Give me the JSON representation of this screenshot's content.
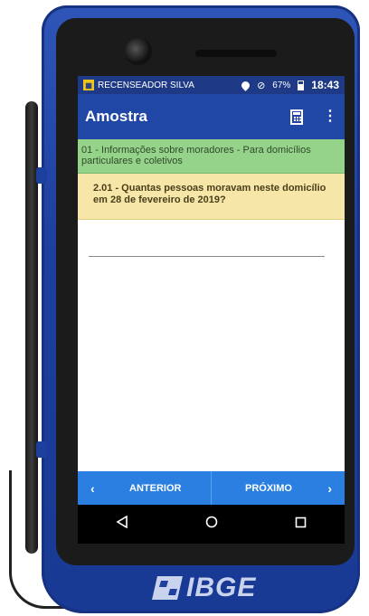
{
  "status_bar": {
    "app_name": "RECENSEADOR SILVA",
    "battery": "67%",
    "time": "18:43",
    "icons": [
      "location-pin-icon",
      "wifi-off-icon",
      "battery-icon"
    ]
  },
  "app_bar": {
    "title": "Amostra",
    "actions": [
      "calculator-icon",
      "more-vert-icon"
    ]
  },
  "section": {
    "text": "01 - Informações sobre moradores - Para domicílios particulares e coletivos"
  },
  "question": {
    "text": "2.01 - Quantas pessoas moravam neste domicílio em 28 de fevereiro de 2019?"
  },
  "answer": {
    "value": ""
  },
  "navigation": {
    "prev_label": "ANTERIOR",
    "next_label": "PRÓXIMO",
    "prev_arrow": "‹",
    "next_arrow": "›"
  },
  "device": {
    "brand": "IBGE"
  },
  "colors": {
    "status_bar": "#1e3a86",
    "app_bar": "#2046a6",
    "section_bg": "#96d38a",
    "question_bg": "#f6e7a8",
    "nav_bg": "#2b7fe0",
    "device_body": "#1d3f9e"
  }
}
